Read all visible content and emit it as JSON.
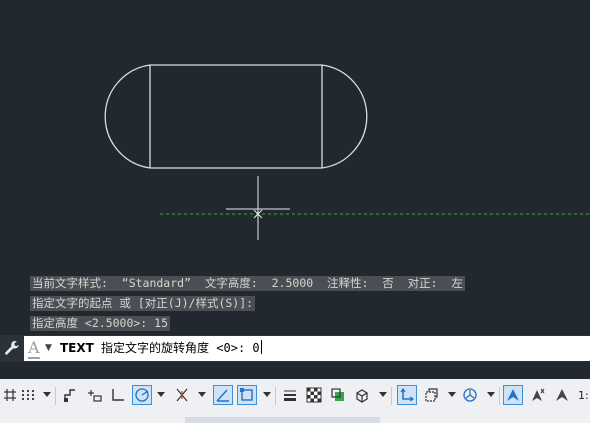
{
  "history": {
    "line1": "当前文字样式:  “Standard”  文字高度:  2.5000  注释性:  否  对正:  左",
    "line2": "指定文字的起点 或 [对正(J)/样式(S)]:",
    "line3": "指定高度 <2.5000>: 15"
  },
  "command": {
    "name": "TEXT",
    "prompt": " 指定文字的旋转角度 <0>: ",
    "value": "0"
  },
  "statusbar": {
    "scale": "1:"
  },
  "colors": {
    "background": "#212830",
    "shape_stroke": "#d9dde2",
    "tracking_line": "#3fae2b",
    "arrow": "#e53a35"
  }
}
